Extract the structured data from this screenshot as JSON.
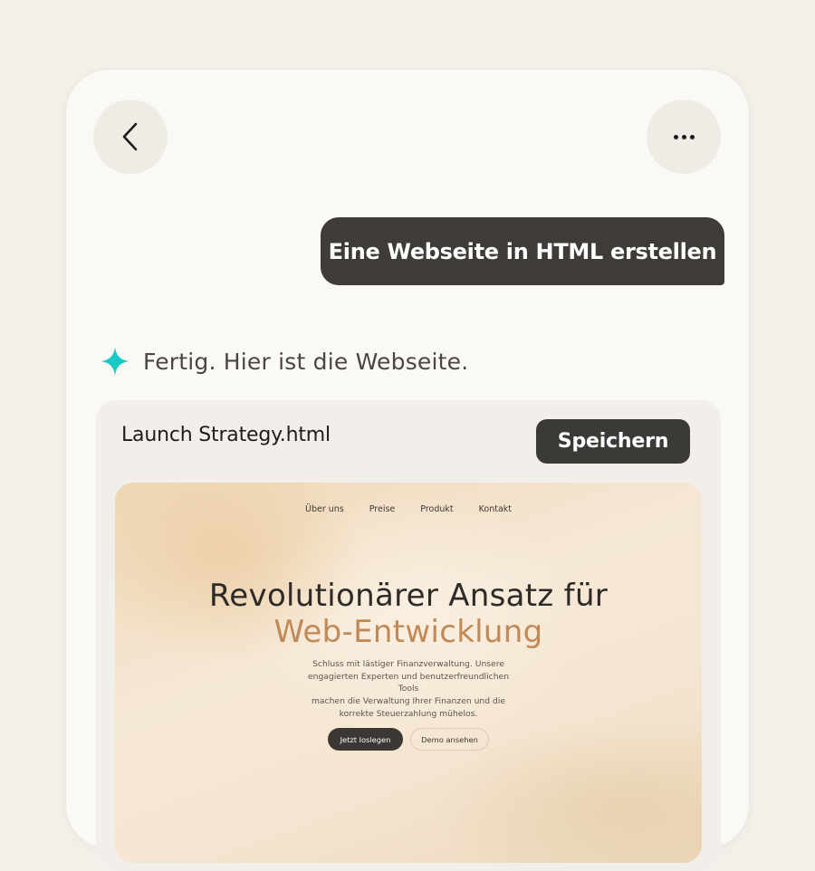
{
  "header": {
    "back_icon": "chevron-left-icon",
    "more_icon": "more-horizontal-icon"
  },
  "chat": {
    "user_message": "Eine Webseite in HTML erstellen",
    "assistant_icon": "sparkle-icon",
    "assistant_message": "Fertig. Hier ist die Webseite."
  },
  "file": {
    "name": "Launch Strategy.html",
    "save_label": "Speichern"
  },
  "preview": {
    "nav": [
      "Über uns",
      "Preise",
      "Produkt",
      "Kontakt"
    ],
    "title_line1": "Revolutionärer Ansatz für",
    "title_line2": "Web-Entwicklung",
    "description_lines": [
      "Schluss mit lästiger Finanzverwaltung. Unsere",
      "engagierten Experten und benutzerfreundlichen Tools",
      "machen die Verwaltung Ihrer Finanzen und die",
      "korrekte Steuerzahlung mühelos."
    ],
    "primary_cta": "Jetzt loslegen",
    "secondary_cta": "Demo ansehen"
  },
  "colors": {
    "accent_sparkle": "#19c9c6",
    "title_accent": "#c08a58",
    "dark_button": "#3c3a37"
  }
}
